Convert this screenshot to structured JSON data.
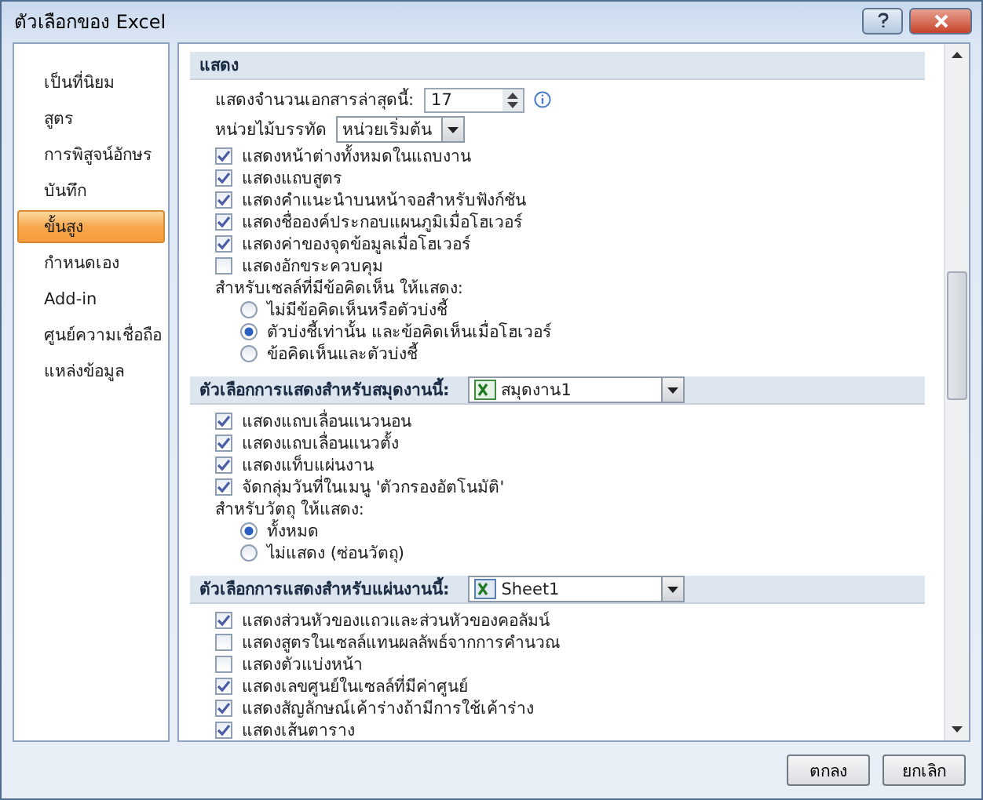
{
  "window": {
    "title": "ตัวเลือกของ Excel"
  },
  "sidebar": {
    "items": [
      {
        "label": "เป็นที่นิยม",
        "selected": false
      },
      {
        "label": "สูตร",
        "selected": false
      },
      {
        "label": "การพิสูจน์อักษร",
        "selected": false
      },
      {
        "label": "บันทึก",
        "selected": false
      },
      {
        "label": "ขั้นสูง",
        "selected": true
      },
      {
        "label": "กำหนดเอง",
        "selected": false
      },
      {
        "label": "Add-in",
        "selected": false
      },
      {
        "label": "ศูนย์ความเชื่อถือ",
        "selected": false
      },
      {
        "label": "แหล่งข้อมูล",
        "selected": false
      }
    ]
  },
  "sections": [
    {
      "title": "แสดง",
      "items": [
        {
          "kind": "spinner",
          "label": "แสดงจำนวนเอกสารล่าสุดนี้:",
          "value": "17"
        },
        {
          "kind": "dropdown",
          "label": "หน่วยไม้บรรทัด",
          "value": "หน่วยเริ่มต้น"
        },
        {
          "kind": "checkbox",
          "label": "แสดงหน้าต่างทั้งหมดในแถบงาน",
          "checked": true
        },
        {
          "kind": "checkbox",
          "label": "แสดงแถบสูตร",
          "checked": true
        },
        {
          "kind": "checkbox",
          "label": "แสดงคำแนะนำบนหน้าจอสำหรับฟังก์ชัน",
          "checked": true
        },
        {
          "kind": "checkbox",
          "label": "แสดงชื่อองค์ประกอบแผนภูมิเมื่อโฮเวอร์",
          "checked": true
        },
        {
          "kind": "checkbox",
          "label": "แสดงค่าของจุดข้อมูลเมื่อโฮเวอร์",
          "checked": true
        },
        {
          "kind": "checkbox",
          "label": "แสดงอักขระควบคุม",
          "checked": false
        },
        {
          "kind": "label",
          "label": "สำหรับเซลล์ที่มีข้อคิดเห็น ให้แสดง:"
        },
        {
          "kind": "radio",
          "label": "ไม่มีข้อคิดเห็นหรือตัวบ่งชี้",
          "selected": false
        },
        {
          "kind": "radio",
          "label": "ตัวบ่งชี้เท่านั้น และข้อคิดเห็นเมื่อโฮเวอร์",
          "selected": true
        },
        {
          "kind": "radio",
          "label": "ข้อคิดเห็นและตัวบ่งชี้",
          "selected": false
        }
      ]
    },
    {
      "title": "ตัวเลือกการแสดงสำหรับสมุดงานนี้:",
      "select": {
        "kind": "workbook",
        "value": "สมุดงาน1"
      },
      "items": [
        {
          "kind": "checkbox",
          "label": "แสดงแถบเลื่อนแนวนอน",
          "checked": true
        },
        {
          "kind": "checkbox",
          "label": "แสดงแถบเลื่อนแนวตั้ง",
          "checked": true
        },
        {
          "kind": "checkbox",
          "label": "แสดงแท็บแผ่นงาน",
          "checked": true
        },
        {
          "kind": "checkbox",
          "label": "จัดกลุ่มวันที่ในเมนู 'ตัวกรองอัตโนมัติ'",
          "checked": true
        },
        {
          "kind": "label",
          "label": "สำหรับวัตถุ ให้แสดง:"
        },
        {
          "kind": "radio",
          "label": "ทั้งหมด",
          "selected": true
        },
        {
          "kind": "radio",
          "label": "ไม่แสดง (ซ่อนวัตถุ)",
          "selected": false
        }
      ]
    },
    {
      "title": "ตัวเลือกการแสดงสำหรับแผ่นงานนี้:",
      "select": {
        "kind": "sheet",
        "value": "Sheet1"
      },
      "items": [
        {
          "kind": "checkbox",
          "label": "แสดงส่วนหัวของแถวและส่วนหัวของคอลัมน์",
          "checked": true
        },
        {
          "kind": "checkbox",
          "label": "แสดงสูตรในเซลล์แทนผลลัพธ์จากการคำนวณ",
          "checked": false
        },
        {
          "kind": "checkbox",
          "label": "แสดงตัวแบ่งหน้า",
          "checked": false
        },
        {
          "kind": "checkbox",
          "label": "แสดงเลขศูนย์ในเซลล์ที่มีค่าศูนย์",
          "checked": true
        },
        {
          "kind": "checkbox",
          "label": "แสดงสัญลักษณ์เค้าร่างถ้ามีการใช้เค้าร่าง",
          "checked": true
        },
        {
          "kind": "checkbox",
          "label": "แสดงเส้นตาราง",
          "checked": true
        }
      ]
    }
  ],
  "buttons": [
    "ตกลง",
    "ยกเลิก"
  ]
}
